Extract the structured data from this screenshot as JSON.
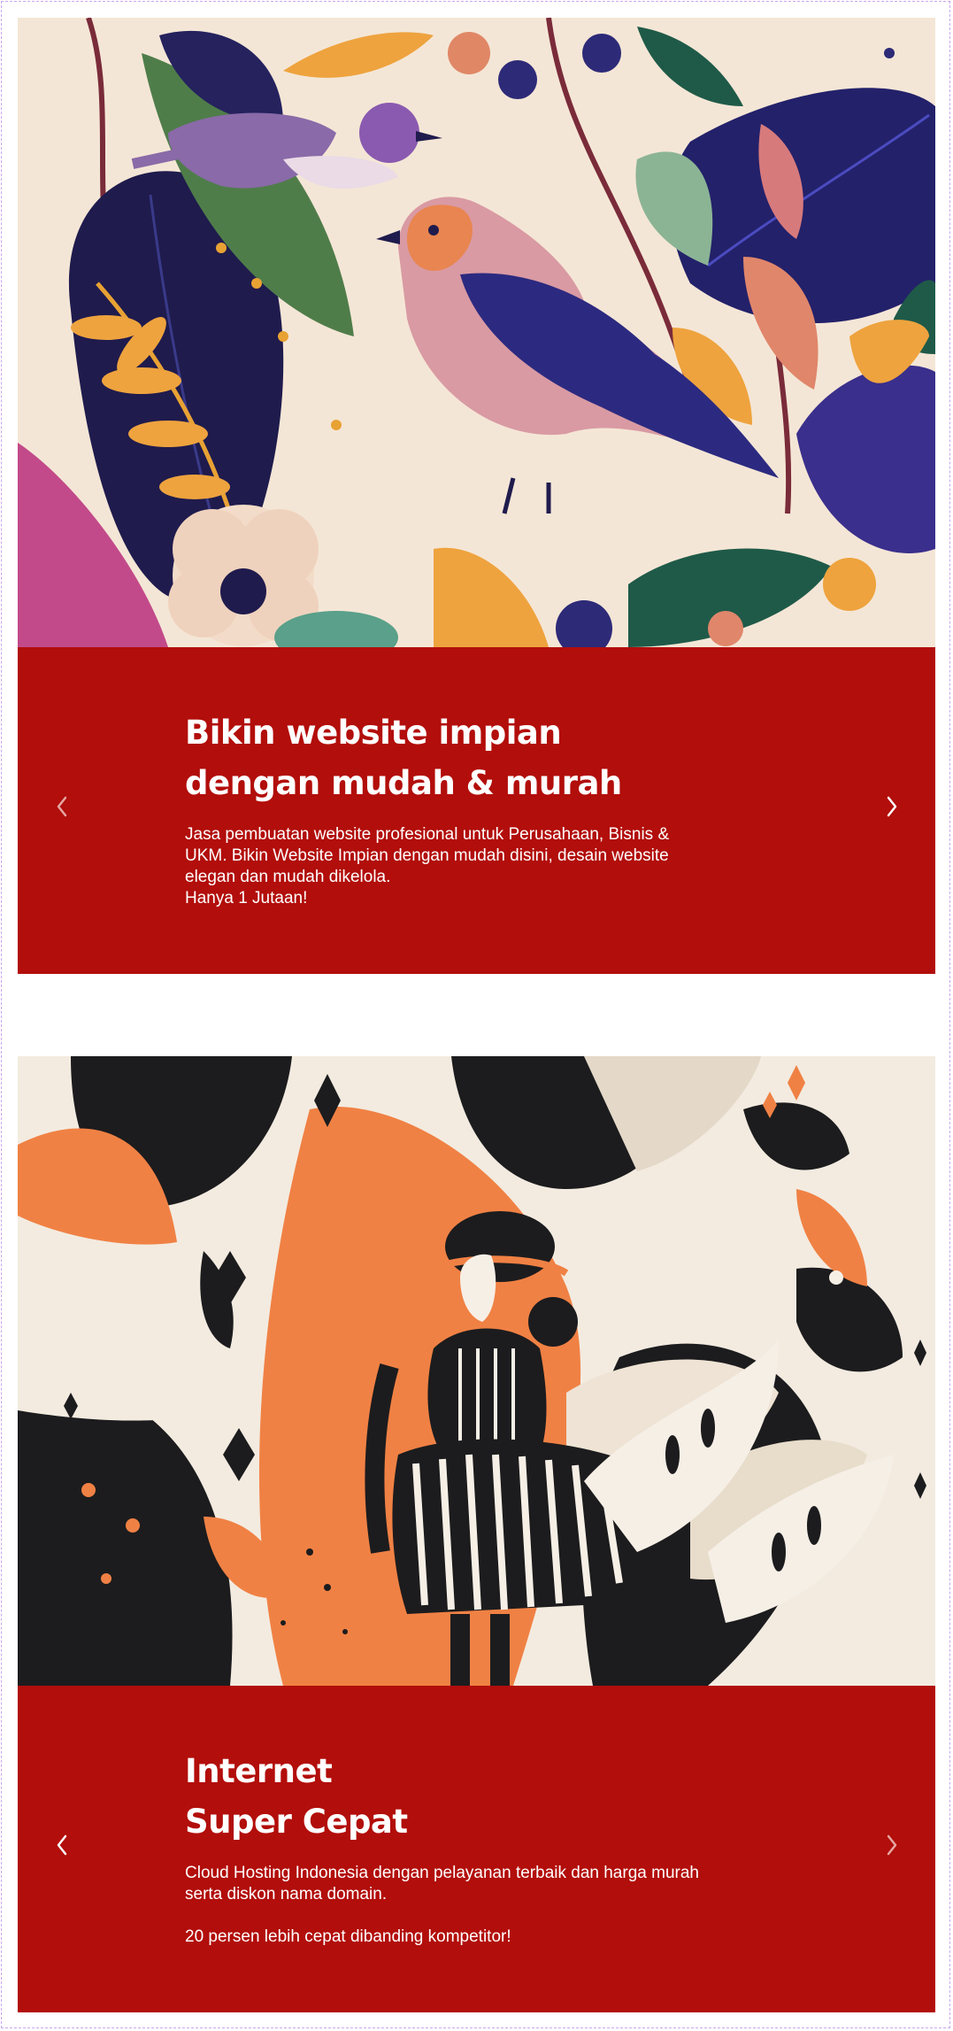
{
  "colors": {
    "caption_bg": "#b20e0b",
    "frame_border": "#c9a6ee",
    "text": "#ffffff"
  },
  "slides": [
    {
      "image_icon": "bird-botanical-illustration-icon",
      "title_line1": "Bikin website impian",
      "title_line2": "dengan mudah & murah",
      "desc_lines": [
        "Jasa pembuatan website profesional untuk Perusahaan, Bisnis &",
        "UKM. Bikin Website Impian dengan mudah disini, desain website",
        "elegan dan mudah dikelola.",
        "Hanya 1 Jutaan!"
      ],
      "prev_icon": "chevron-left-icon",
      "next_icon": "chevron-right-icon"
    },
    {
      "image_icon": "woman-abstract-illustration-icon",
      "title_line1": "Internet",
      "title_line2": "Super Cepat",
      "desc_lines": [
        "Cloud Hosting Indonesia dengan pelayanan terbaik dan harga murah",
        "serta diskon nama domain.",
        "20 persen lebih cepat dibanding kompetitor!"
      ],
      "prev_icon": "chevron-left-icon",
      "next_icon": "chevron-right-icon"
    }
  ]
}
